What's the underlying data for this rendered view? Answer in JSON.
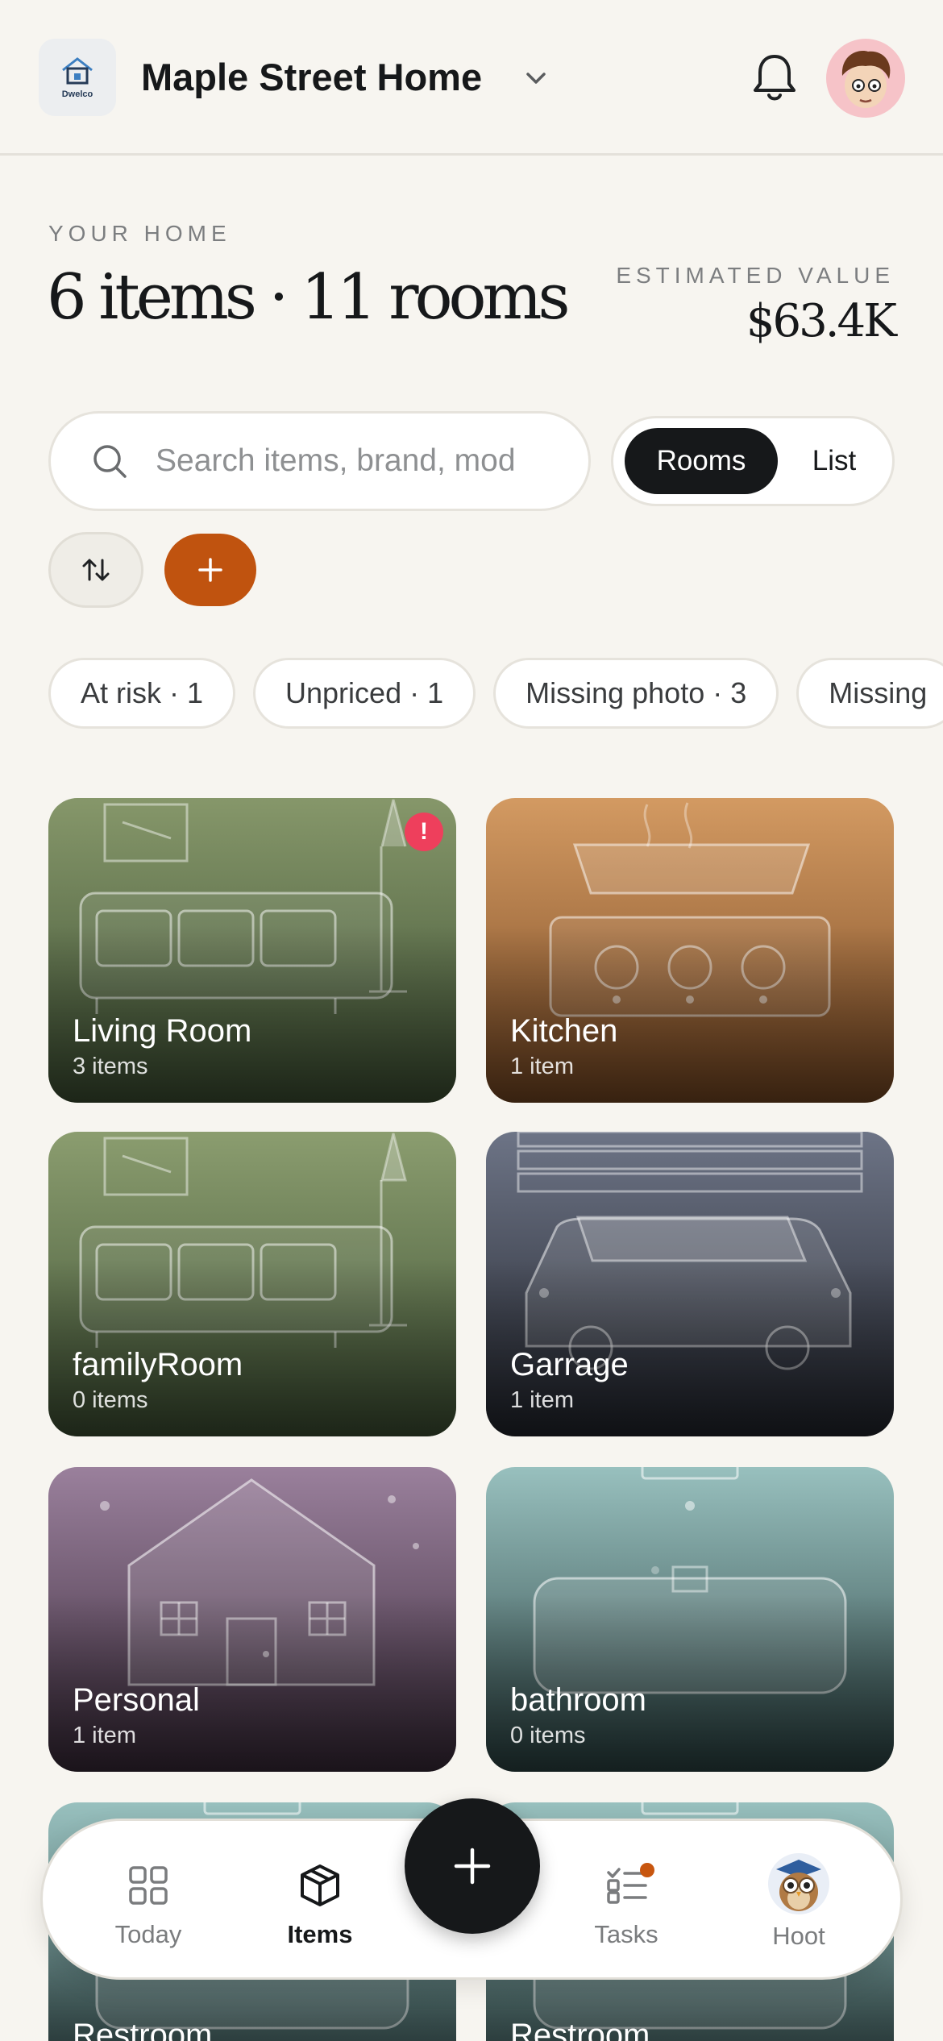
{
  "header": {
    "logo_text": "Dwelco",
    "home_name": "Maple Street Home"
  },
  "summary": {
    "overline": "YOUR HOME",
    "headline": "6 items · 11 rooms",
    "estimated_label": "ESTIMATED VALUE",
    "estimated_value": "$63.4K"
  },
  "search": {
    "placeholder": "Search items, brand, mod"
  },
  "view_toggle": {
    "rooms": "Rooms",
    "list": "List",
    "selected": "Rooms"
  },
  "chips": [
    "At risk · 1",
    "Unpriced · 1",
    "Missing photo · 3",
    "Missing"
  ],
  "rooms": [
    {
      "name": "Living Room",
      "count": "3 items",
      "alert": "!"
    },
    {
      "name": "Kitchen",
      "count": "1 item"
    },
    {
      "name": "familyRoom",
      "count": "0 items"
    },
    {
      "name": "Garrage",
      "count": "1 item"
    },
    {
      "name": "Personal",
      "count": "1 item"
    },
    {
      "name": "bathroom",
      "count": "0 items"
    },
    {
      "name": "Restroom",
      "count": ""
    },
    {
      "name": "Restroom",
      "count": ""
    }
  ],
  "tabbar": {
    "today": "Today",
    "items": "Items",
    "tasks": "Tasks",
    "hoot": "Hoot",
    "active": "Items"
  },
  "colors": {
    "accent": "#c0530f",
    "alert": "#ee3f5c",
    "dark": "#16181a"
  }
}
